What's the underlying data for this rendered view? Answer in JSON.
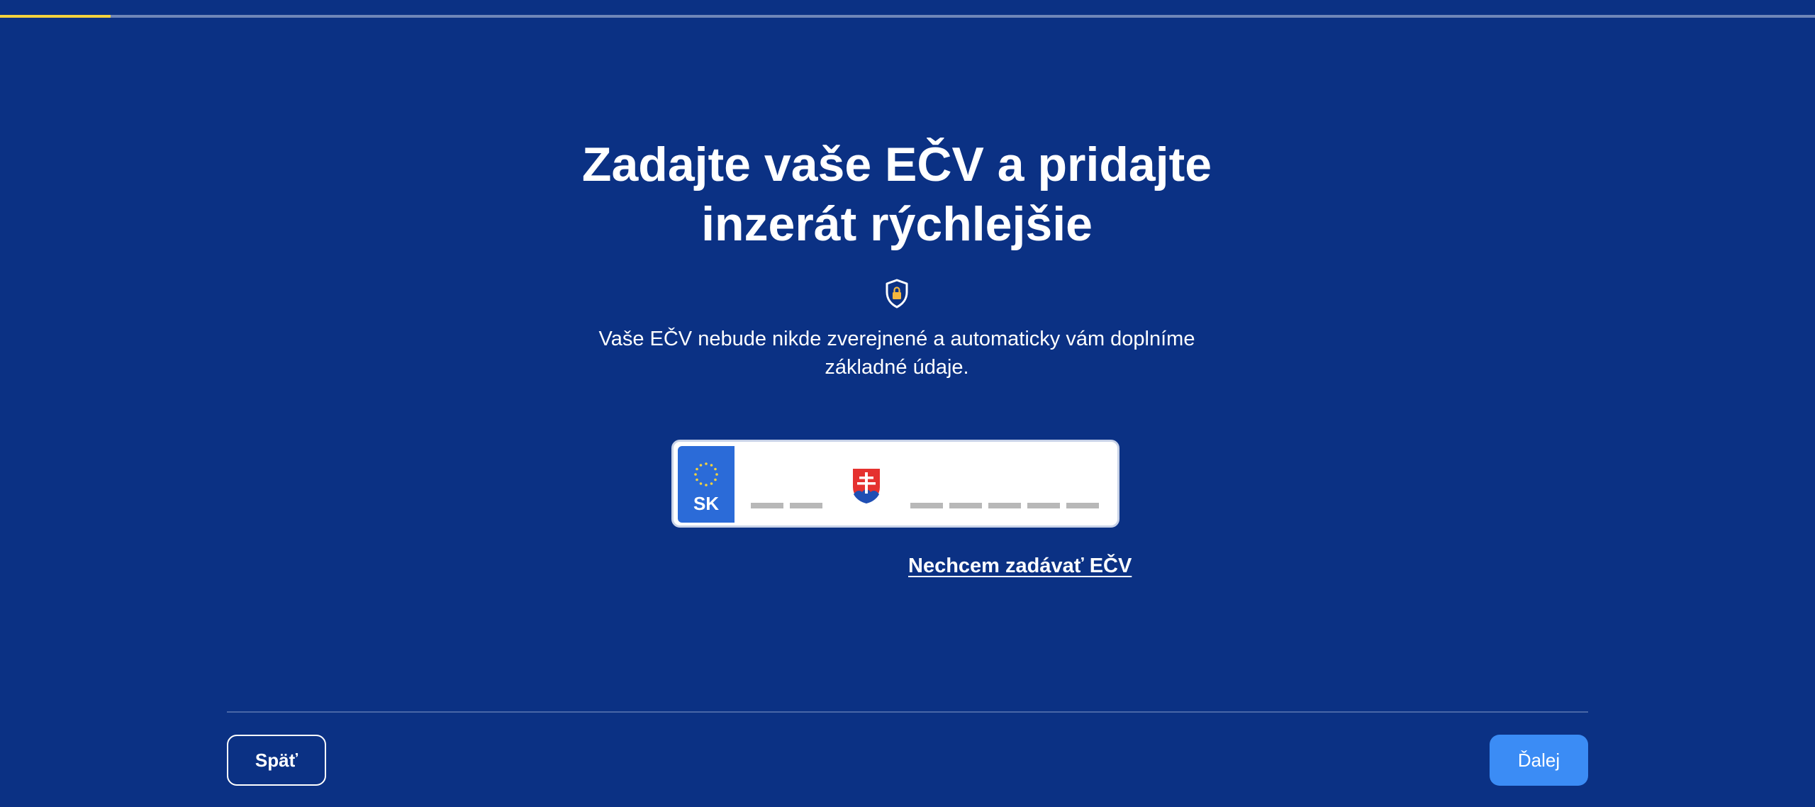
{
  "progress": {
    "fraction": 0.061,
    "fill_color": "#f4d23e",
    "track_color": "#6f86b8"
  },
  "heading": {
    "line1": "Zadajte vaše EČV a pridajte",
    "line2": "inzerát rýchlejšie"
  },
  "privacy_icon": "shield-lock-icon",
  "subtitle": {
    "line1": "Vaše EČV nebude nikde zverejnené a automaticky vám doplníme",
    "line2": "základné údaje."
  },
  "plate": {
    "country_code": "SK",
    "eu_band_color": "#2b6bd8",
    "emblem_icon": "slovak-coat-of-arms-icon",
    "value": ""
  },
  "skip_link": "Nechcem zadávať EČV",
  "footer": {
    "back_label": "Späť",
    "next_label": "Ďalej",
    "next_color": "#3b8cf5"
  },
  "colors": {
    "background": "#0b3184",
    "accent": "#f4d23e"
  }
}
